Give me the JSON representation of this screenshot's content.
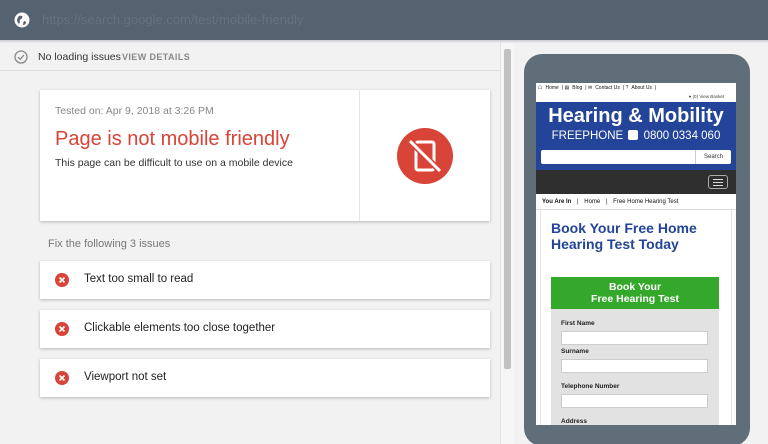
{
  "topbar": {
    "url": "https://search.google.com/test/mobile-friendly"
  },
  "status": {
    "text": "No loading issues",
    "details_label": "VIEW DETAILS"
  },
  "result": {
    "tested_on": "Tested on: Apr 9, 2018 at 3:26 PM",
    "headline": "Page is not mobile friendly",
    "subtext": "This page can be difficult to use on a mobile device",
    "accent_color": "#d84437"
  },
  "issues": {
    "title": "Fix the following 3 issues",
    "items": [
      {
        "label": "Text too small to read"
      },
      {
        "label": "Clickable elements too close together"
      },
      {
        "label": "Viewport not set"
      }
    ]
  },
  "preview": {
    "nav": [
      "Home",
      "Blog",
      "Contact Us",
      "About Us"
    ],
    "basket": "(0) View Basket",
    "brand": "Hearing & Mobility",
    "freephone_label": "FREEPHONE",
    "phone_number": "0800 0334 060",
    "search_button": "Search",
    "breadcrumb": {
      "prefix": "You Are In",
      "items": [
        "Home",
        "Free Home Hearing Test"
      ]
    },
    "title": "Book Your Free Home Hearing Test Today",
    "cta": {
      "line1": "Book Your",
      "line2": "Free Hearing Test"
    },
    "form_fields": [
      "First Name",
      "Surname",
      "Telephone Number",
      "Address"
    ],
    "brand_color": "#24449a",
    "cta_color": "#34a82b"
  }
}
